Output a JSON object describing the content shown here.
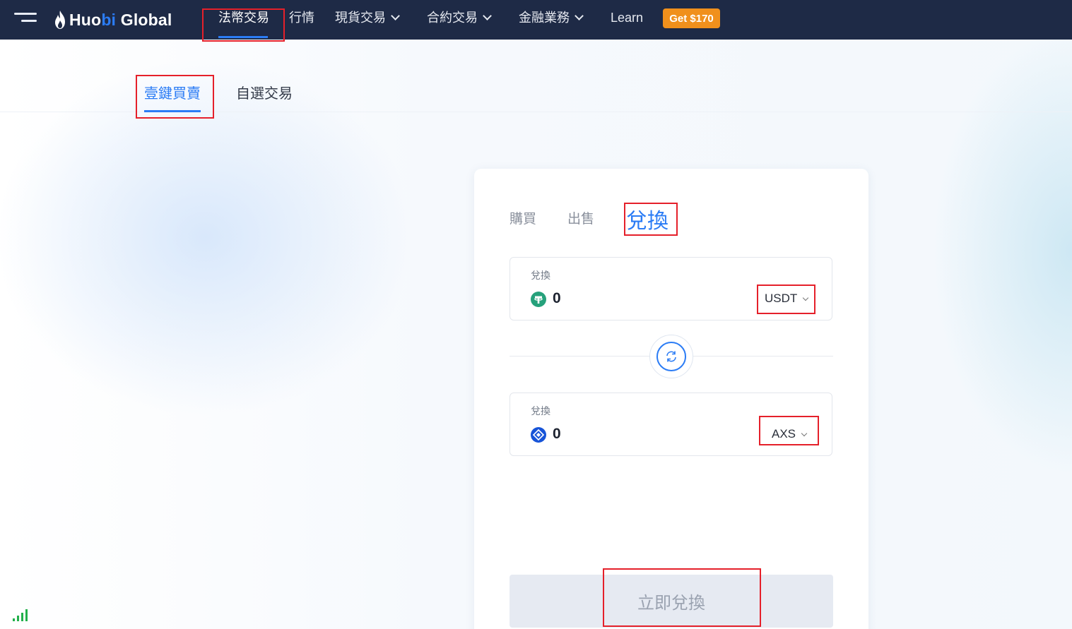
{
  "header": {
    "logo": {
      "prefix": "Huo",
      "highlight": "bi",
      "suffix": " Global"
    },
    "nav": [
      {
        "label": "法幣交易",
        "active": true,
        "dropdown": false
      },
      {
        "label": "行情",
        "active": false,
        "dropdown": false
      },
      {
        "label": "現貨交易",
        "active": false,
        "dropdown": true
      },
      {
        "label": "合約交易",
        "active": false,
        "dropdown": true
      },
      {
        "label": "金融業務",
        "active": false,
        "dropdown": true
      },
      {
        "label": "Learn",
        "active": false,
        "dropdown": false
      }
    ],
    "promo_label": "Get $170"
  },
  "subtabs": [
    {
      "label": "壹鍵買賣",
      "active": true
    },
    {
      "label": "自選交易",
      "active": false
    }
  ],
  "card": {
    "tabs": [
      {
        "label": "購買",
        "active": false
      },
      {
        "label": "出售",
        "active": false
      },
      {
        "label": "兌換",
        "active": true
      }
    ],
    "from": {
      "label": "兌換",
      "amount": "0",
      "coin": "USDT",
      "icon": "tether-icon"
    },
    "to": {
      "label": "兌換",
      "amount": "0",
      "coin": "AXS",
      "icon": "axie-icon"
    },
    "submit_label": "立即兌換"
  },
  "colors": {
    "nav_bg": "#1e2a46",
    "accent": "#2b7cf5",
    "promo": "#f0901c",
    "highlight_box": "#e5202a",
    "usdt": "#26a17b",
    "axs": "#1754d8",
    "signal": "#22b04b"
  }
}
